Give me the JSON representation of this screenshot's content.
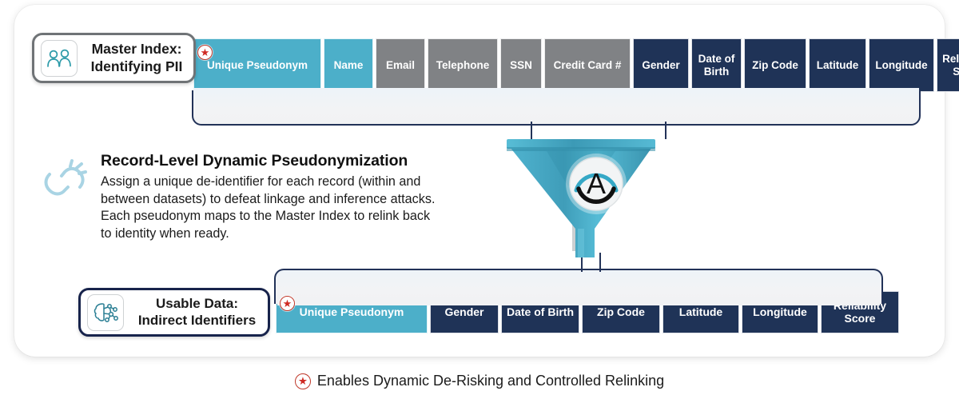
{
  "card": {
    "master_index": {
      "icon": "two-people-icon",
      "line1": "Master Index:",
      "line2": "Identifying PII",
      "border_color": "#6f7376"
    },
    "usable_data": {
      "icon": "brain-network-icon",
      "line1": "Usable Data:",
      "line2": "Indirect Identifiers",
      "border_color": "#17234b"
    },
    "top_row": {
      "star_badge": "red-star-badge",
      "columns": [
        {
          "label": "Unique Pseudonym",
          "style": "teal",
          "width": 160
        },
        {
          "label": "Name",
          "style": "teal",
          "width": 62
        },
        {
          "label": "Email",
          "style": "gray",
          "width": 62
        },
        {
          "label": "Telephone",
          "style": "gray",
          "width": 88
        },
        {
          "label": "SSN",
          "style": "gray",
          "width": 52
        },
        {
          "label": "Credit Card #",
          "style": "gray",
          "width": 108
        },
        {
          "label": "Gender",
          "style": "navy",
          "width": 70
        },
        {
          "label": "Date of Birth",
          "style": "navy",
          "width": 63
        },
        {
          "label": "Zip Code",
          "style": "navy",
          "width": 78
        },
        {
          "label": "Latitude",
          "style": "navy",
          "width": 72
        },
        {
          "label": "Longitude",
          "style": "navy",
          "width": 82
        },
        {
          "label": "Reliability Score",
          "style": "navy",
          "width": 78
        }
      ]
    },
    "bottom_row": {
      "star_badge": "red-star-badge",
      "columns": [
        {
          "label": "Unique Pseudonym",
          "style": "teal",
          "width": 190
        },
        {
          "label": "Gender",
          "style": "navy",
          "width": 86
        },
        {
          "label": "Date of Birth",
          "style": "navy",
          "width": 98
        },
        {
          "label": "Zip Code",
          "style": "navy",
          "width": 98
        },
        {
          "label": "Latitude",
          "style": "navy",
          "width": 96
        },
        {
          "label": "Longitude",
          "style": "navy",
          "width": 96
        },
        {
          "label": "Reliability Score",
          "style": "navy",
          "width": 98
        }
      ]
    },
    "description": {
      "icon": "broken-link-icon",
      "title": "Record-Level Dynamic Pseudonymization",
      "body": "Assign a unique de-identifier for each record (within and between datasets) to defeat linkage and inference attacks. Each pseudonym maps to the Master Index to relink back to identity when ready."
    },
    "funnel": {
      "icon": "funnel-icon",
      "badge": "anonos-a-logo",
      "badge_letter": "A"
    }
  },
  "footer": {
    "star_badge": "red-star-badge",
    "text": "Enables Dynamic De-Risking and Controlled Relinking"
  },
  "colors": {
    "teal": "#4cafc9",
    "gray": "#808285",
    "navy": "#1f3357",
    "star_red": "#cf2b24",
    "tray": "#f1f2f4"
  }
}
